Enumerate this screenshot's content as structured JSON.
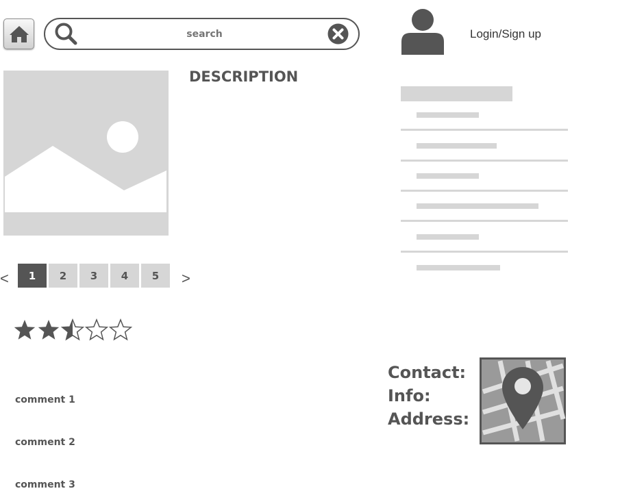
{
  "header": {
    "home_icon": "home-icon",
    "search": {
      "placeholder": "search",
      "value": "",
      "search_icon": "search-icon",
      "clear_icon": "close-circle-icon"
    },
    "user": {
      "avatar_icon": "user-avatar-icon",
      "login_label": "Login/Sign up"
    }
  },
  "product": {
    "image_icon": "image-placeholder-icon",
    "description_title": "DESCRIPTION"
  },
  "pagination": {
    "prev_label": "<",
    "next_label": ">",
    "pages": [
      "1",
      "2",
      "3",
      "4",
      "5"
    ],
    "active_page": "1"
  },
  "rating": {
    "value": 2.5,
    "max": 5
  },
  "comments": [
    "comment 1",
    "comment 2",
    "comment 3"
  ],
  "contact": {
    "labels": [
      "Contact:",
      "Info:",
      "Address:"
    ],
    "map_icon": "map-pin-icon"
  },
  "colors": {
    "primary": "#555555",
    "placeholder_gray": "#d6d6d6",
    "background": "#ffffff"
  }
}
